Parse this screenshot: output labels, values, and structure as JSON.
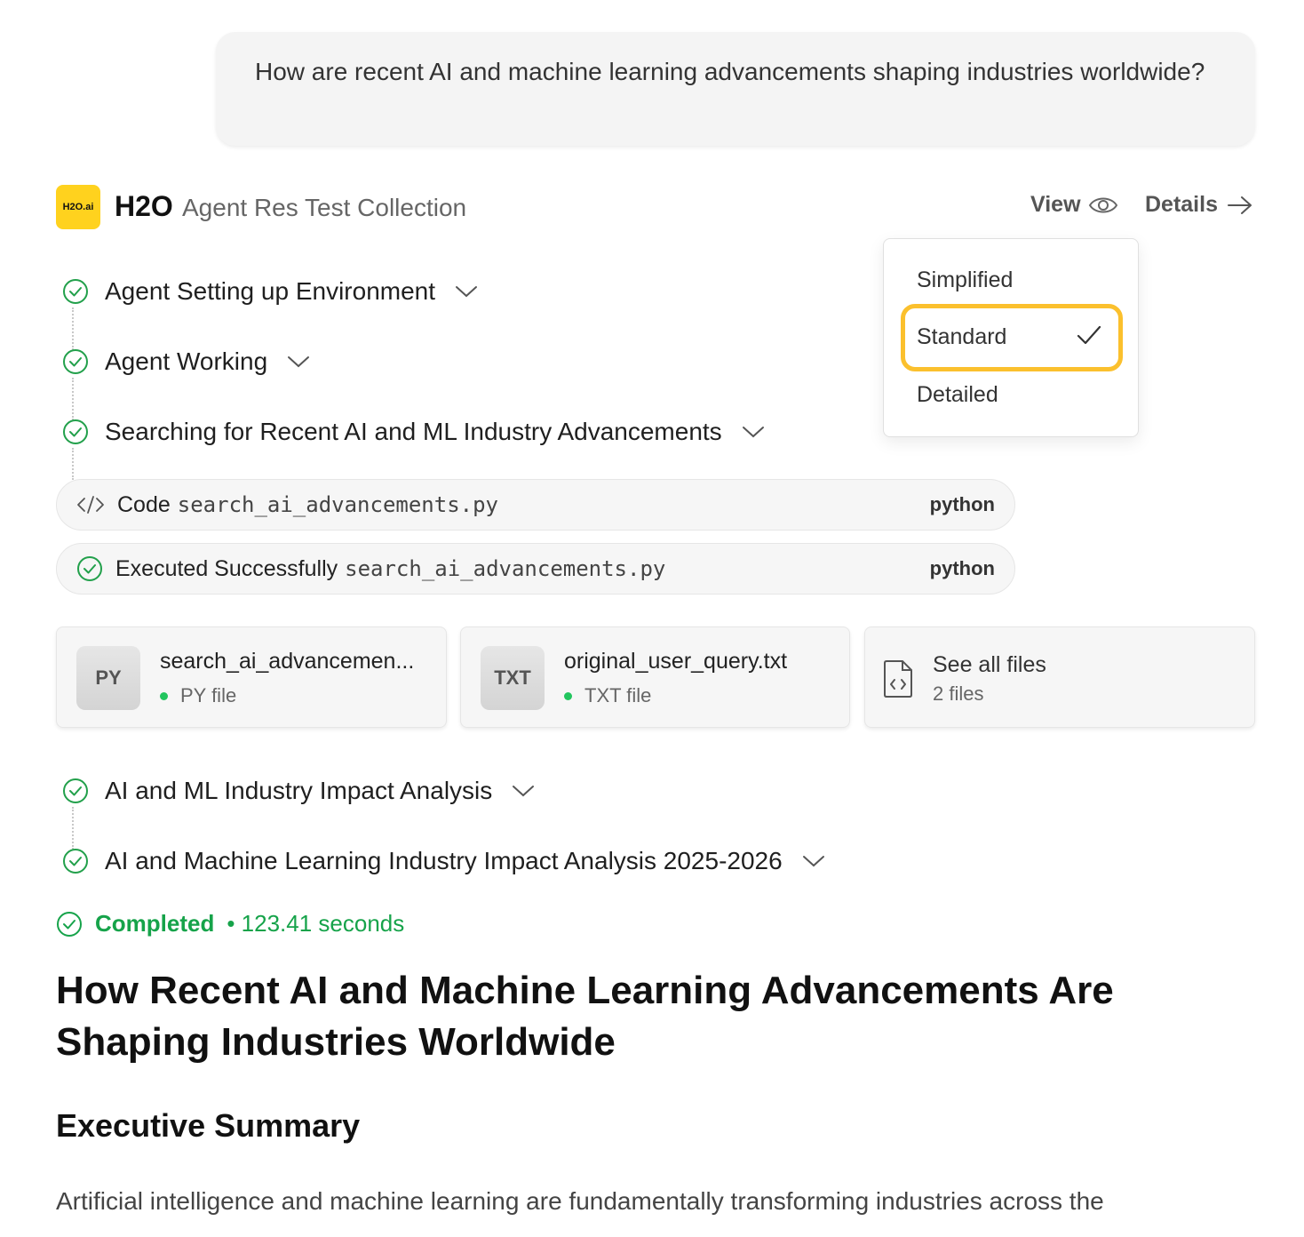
{
  "user_message": "How are recent AI and machine learning advancements shaping industries worldwide?",
  "header": {
    "logo_text": "H2O.ai",
    "brand": "H2O",
    "collection": "Agent Res Test Collection",
    "view_label": "View",
    "details_label": "Details"
  },
  "view_dropdown": {
    "options": [
      "Simplified",
      "Standard",
      "Detailed"
    ],
    "selected": "Standard"
  },
  "steps": [
    {
      "label": "Agent Setting up Environment"
    },
    {
      "label": "Agent Working"
    },
    {
      "label": "Searching for Recent AI and ML Industry Advancements"
    },
    {
      "label": "AI and ML Industry Impact Analysis"
    },
    {
      "label": "AI and Machine Learning Industry Impact Analysis 2025-2026"
    }
  ],
  "code_pill": {
    "label": "Code",
    "file": "search_ai_advancements.py",
    "lang": "python"
  },
  "exec_pill": {
    "label": "Executed Successfully",
    "file": "search_ai_advancements.py",
    "lang": "python"
  },
  "files": [
    {
      "badge": "PY",
      "name": "search_ai_advancemen...",
      "type": "PY file"
    },
    {
      "badge": "TXT",
      "name": "original_user_query.txt",
      "type": "TXT file"
    }
  ],
  "see_all": {
    "label": "See all files",
    "count": "2 files"
  },
  "status": {
    "label": "Completed",
    "time": "• 123.41 seconds"
  },
  "report": {
    "title": "How Recent AI and Machine Learning Advancements Are Shaping Industries Worldwide",
    "section": "Executive Summary",
    "paragraph": "Artificial intelligence and machine learning are fundamentally transforming industries across the"
  },
  "colors": {
    "accent_yellow": "#ffd21e",
    "highlight": "#fbc02d",
    "success": "#16a34a"
  }
}
